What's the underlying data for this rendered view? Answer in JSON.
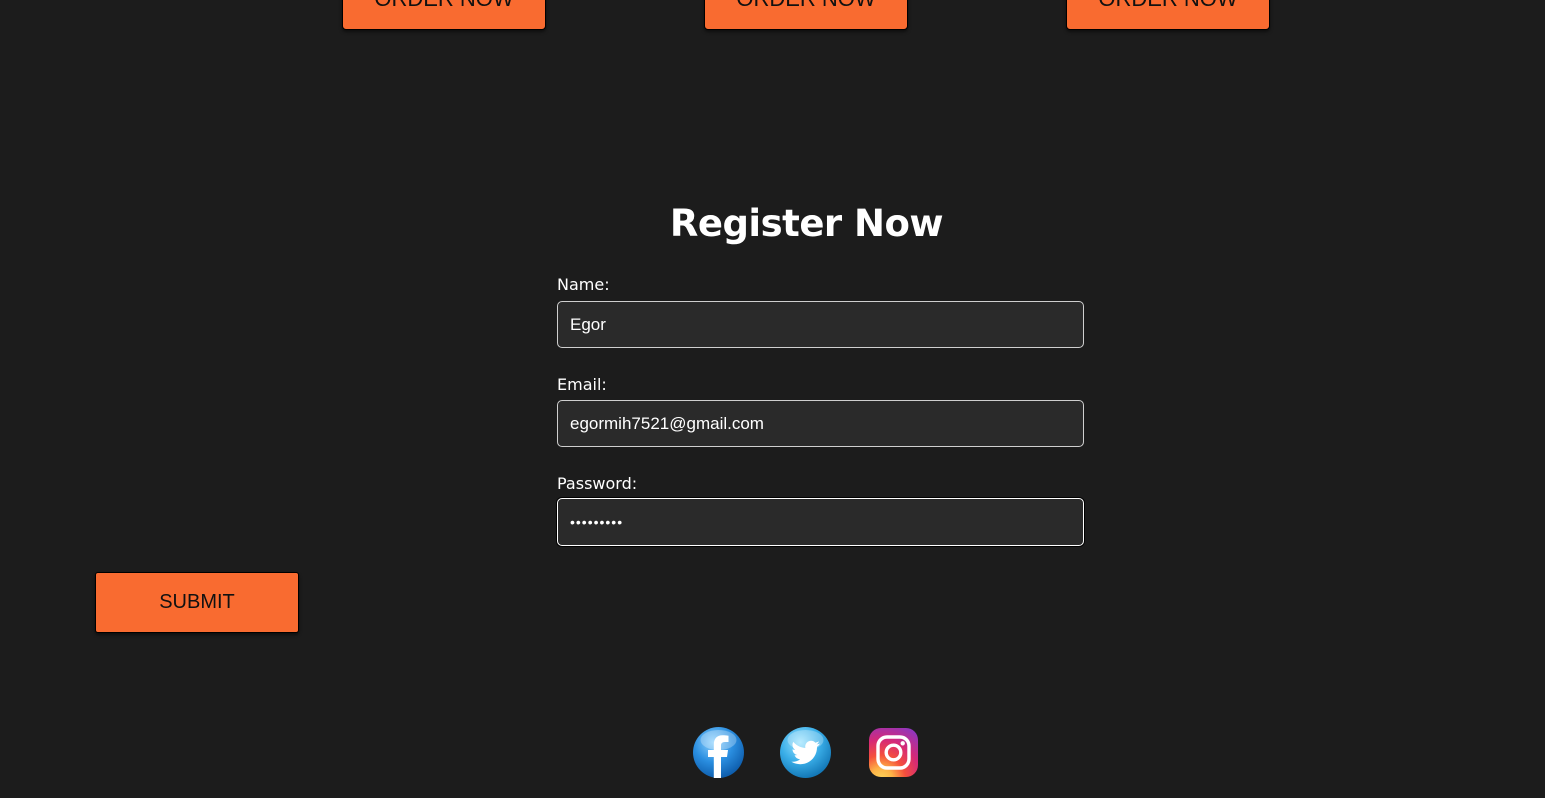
{
  "products": {
    "order_buttons": [
      {
        "label": "ORDER NOW"
      },
      {
        "label": "ORDER NOW"
      },
      {
        "label": "ORDER NOW"
      }
    ]
  },
  "register": {
    "title": "Register Now",
    "fields": {
      "name": {
        "label": "Name:",
        "value": "Egor"
      },
      "email": {
        "label": "Email:",
        "value": "egormih7521@gmail.com"
      },
      "password": {
        "label": "Password:",
        "value": "•••••••••"
      }
    },
    "submit_label": "SUBMIT"
  },
  "social": {
    "icons": [
      "facebook-icon",
      "twitter-icon",
      "instagram-icon"
    ]
  },
  "colors": {
    "background": "#1c1c1c",
    "accent": "#f96b30",
    "input_background": "#2a2a2a"
  }
}
